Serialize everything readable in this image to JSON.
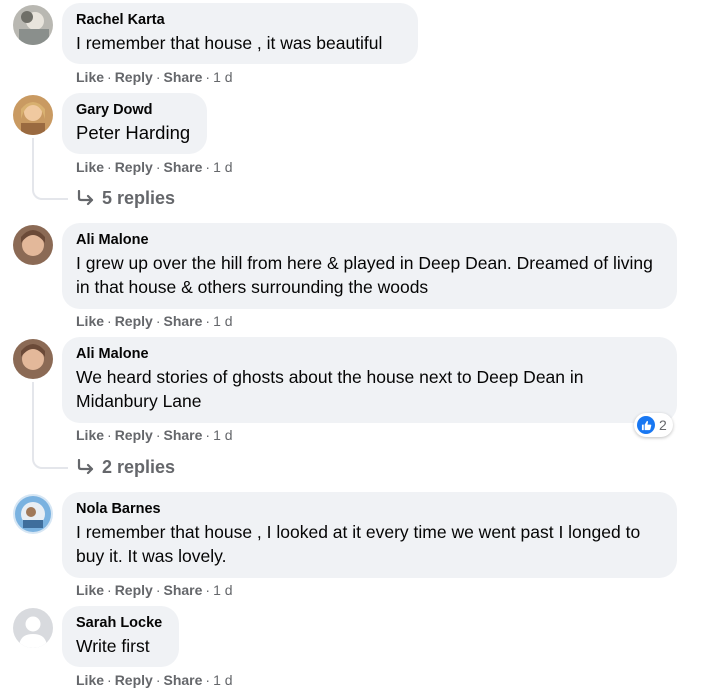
{
  "colors": {
    "bubble": "#f0f2f5",
    "muted": "#65676b",
    "like_blue": "#1877f2"
  },
  "comments": [
    {
      "author": "Rachel Karta",
      "text": "I remember that house , it was beautiful",
      "actions": {
        "like": "Like",
        "reply": "Reply",
        "share": "Share",
        "time": "1 d"
      }
    },
    {
      "author": "Gary Dowd",
      "text": "Peter Harding",
      "actions": {
        "like": "Like",
        "reply": "Reply",
        "share": "Share",
        "time": "1 d"
      },
      "replies_label": "5 replies"
    },
    {
      "author": "Ali Malone",
      "text": "I grew up over the hill from here & played in Deep Dean. Dreamed of living in that house & others surrounding the woods",
      "actions": {
        "like": "Like",
        "reply": "Reply",
        "share": "Share",
        "time": "1 d"
      }
    },
    {
      "author": "Ali Malone",
      "text": "We heard stories of ghosts about the house next to Deep Dean in Midanbury Lane",
      "actions": {
        "like": "Like",
        "reply": "Reply",
        "share": "Share",
        "time": "1 d"
      },
      "reaction_count": "2",
      "replies_label": "2 replies"
    },
    {
      "author": "Nola Barnes",
      "text": "I remember that house , I looked at it every time we went past I longed to buy it. It was lovely.",
      "actions": {
        "like": "Like",
        "reply": "Reply",
        "share": "Share",
        "time": "1 d"
      }
    },
    {
      "author": "Sarah Locke",
      "text": "Write first",
      "actions": {
        "like": "Like",
        "reply": "Reply",
        "share": "Share",
        "time": "1 d"
      }
    }
  ]
}
